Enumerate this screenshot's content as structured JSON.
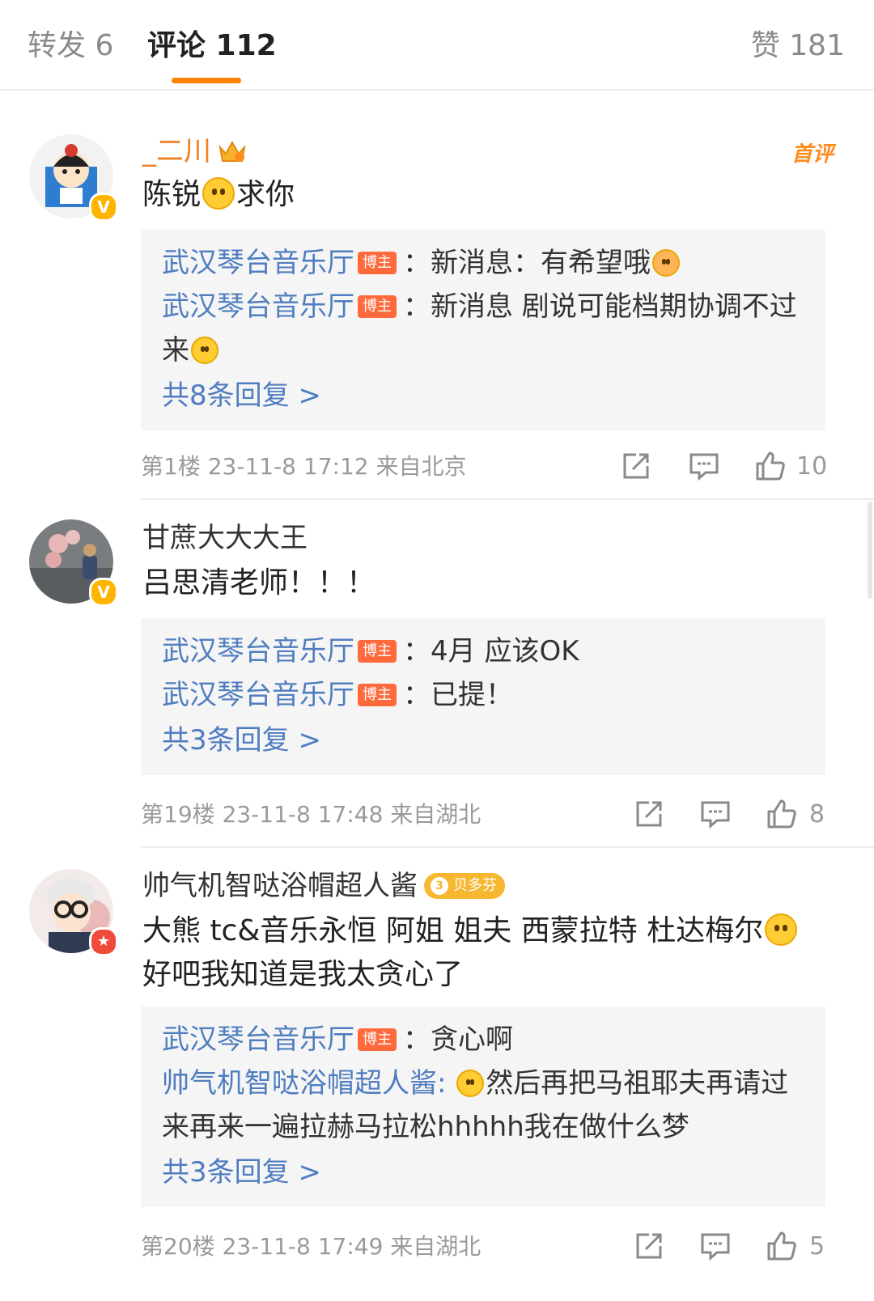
{
  "tabs": {
    "repost": "转发 6",
    "comments": "评论 112",
    "likes": "赞 181"
  },
  "colors": {
    "accent": "#ff8200",
    "link": "#4f7dbf",
    "meta": "#9a9a9a",
    "reply_bg": "#f5f5f5"
  },
  "comments": [
    {
      "username": "_二川",
      "badge_icon": "crown-icon",
      "first_comment_label": "首评",
      "text_before_emoji": "陈锐",
      "text_after_emoji": "求你",
      "replies": [
        {
          "user": "武汉琴台音乐厅",
          "tag": "博主",
          "text_before": "：新消息：有希望哦",
          "text_after": ""
        },
        {
          "user": "武汉琴台音乐厅",
          "tag": "博主",
          "text_before": "：新消息 剧说可能档期协调不过来",
          "text_after": ""
        }
      ],
      "more": "共8条回复 >",
      "meta": "第1楼 23-11-8 17:12 来自北京",
      "likes": "10"
    },
    {
      "username": "甘蔗大大大王",
      "text": "吕思清老师！！！",
      "replies": [
        {
          "user": "武汉琴台音乐厅",
          "tag": "博主",
          "text": "：4月 应该OK"
        },
        {
          "user": "武汉琴台音乐厅",
          "tag": "博主",
          "text": "：已提！"
        }
      ],
      "more": "共3条回复 >",
      "meta": "第19楼 23-11-8 17:48 来自湖北",
      "likes": "8"
    },
    {
      "username": "帅气机智哒浴帽超人酱",
      "fan_level": "3",
      "fan_label": "贝多芬",
      "text_line1": "大熊 tc&音乐永恒 阿姐 姐夫 西蒙拉特 杜达梅尔",
      "text_line2": "好吧我知道是我太贪心了",
      "replies": [
        {
          "user": "武汉琴台音乐厅",
          "tag": "博主",
          "text": "：贪心啊"
        },
        {
          "user": "帅气机智哒浴帽超人酱",
          "text": "然后再把马祖耶夫再请过来再来一遍拉赫马拉松hhhhh我在做什么梦"
        }
      ],
      "more": "共3条回复 >",
      "meta": "第20楼 23-11-8 17:49 来自湖北",
      "likes": "5"
    }
  ],
  "icons": [
    "share-icon",
    "reply-icon",
    "thumbs-up-icon"
  ]
}
